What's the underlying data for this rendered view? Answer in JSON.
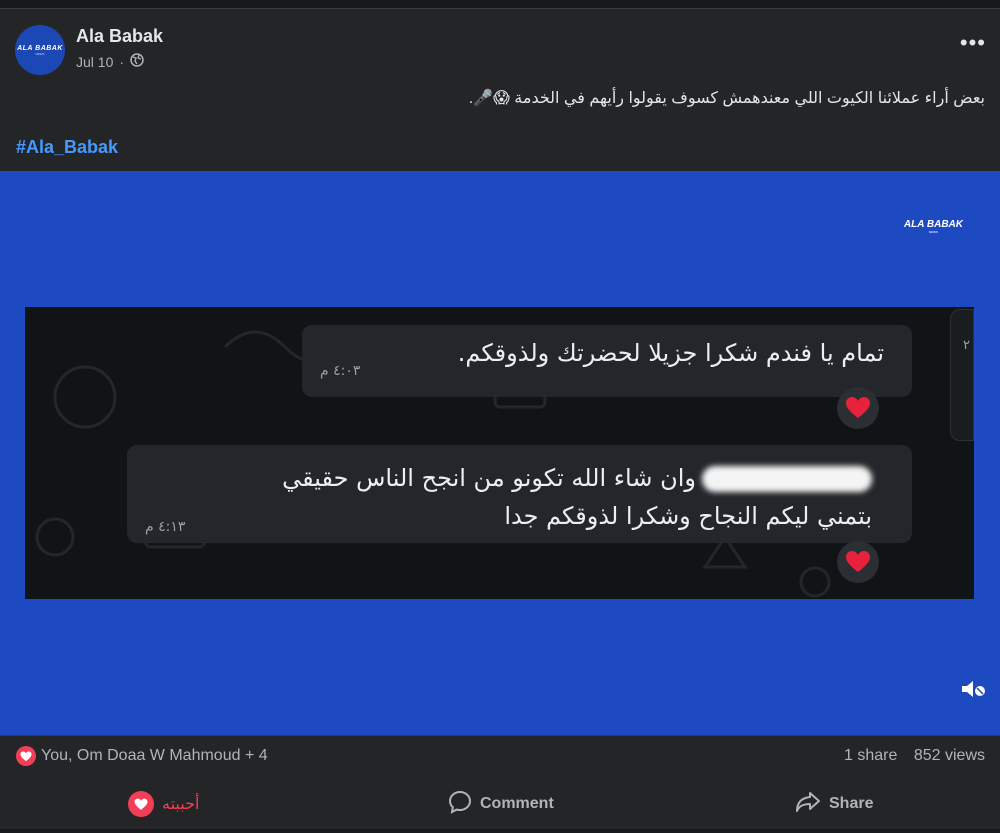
{
  "post": {
    "page_name": "Ala Babak",
    "date": "Jul 10",
    "separator": "·",
    "avatar_text": "ALA BABAK",
    "avatar_sub": "NEWS",
    "caption": "بعض أراء عملائنا الكيوت اللي معندهمش كسوف يقولوا رأيهم في الخدمة 😱🎤.",
    "hashtag": "#Ala_Babak"
  },
  "media": {
    "logo_text": "ALA BABAK",
    "logo_sub": "NEWS",
    "messages": [
      {
        "text": "تمام يا فندم شكرا جزيلا لحضرتك ولذوقكم.",
        "time": "٤:٠٣ م"
      },
      {
        "line1": "وان شاء الله تكونو من انجح الناس حقيقي",
        "line2": "بتمني ليكم النجاح وشكرا لذوقكم جدا",
        "time": "٤:١٣ م"
      }
    ],
    "side_marker": "٢"
  },
  "footer": {
    "reactions": "You, Om Doaa W Mahmoud + 4",
    "shares": "1 share",
    "views": "852 views",
    "like_label": "أحببته",
    "comment_label": "Comment",
    "share_label": "Share"
  },
  "colors": {
    "background": "#242526",
    "media_blue": "#1d4ac0",
    "link_blue": "#4599ff",
    "love_red": "#f33e58"
  },
  "icons": [
    "globe-icon",
    "more-icon",
    "heart-icon",
    "mute-icon",
    "comment-icon",
    "share-icon"
  ]
}
